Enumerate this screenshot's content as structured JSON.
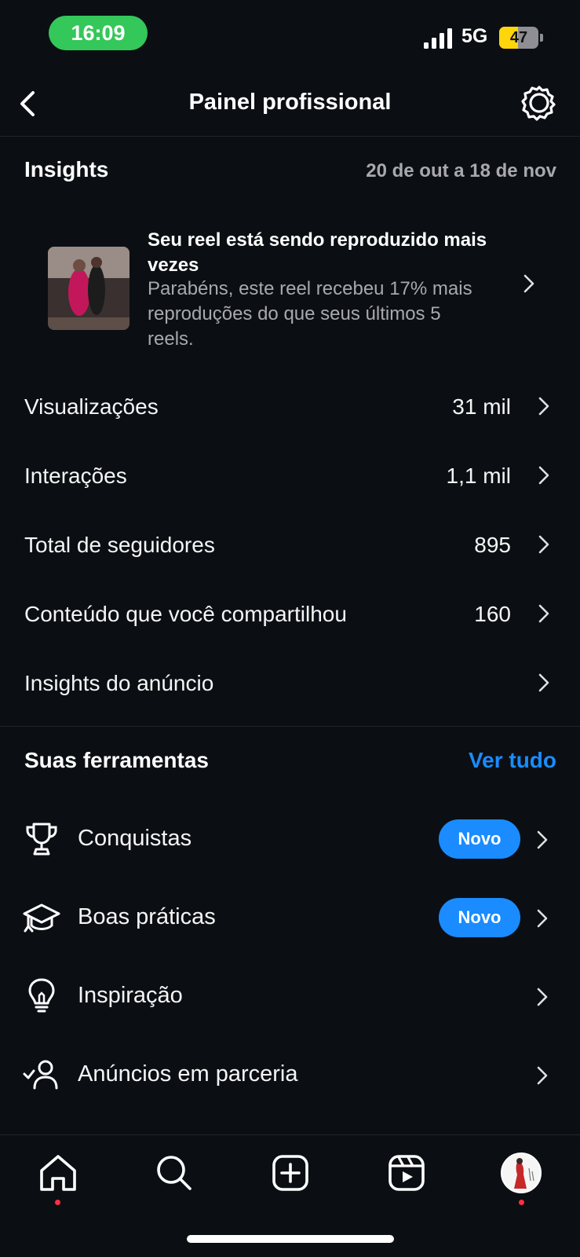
{
  "status_bar": {
    "time": "16:09",
    "network": "5G",
    "battery": "47",
    "battery_level": 0.47,
    "time_pill_color": "#34c759"
  },
  "header": {
    "title": "Painel profissional",
    "back_icon": "chevron-left-icon",
    "settings_icon": "settings-gear-icon"
  },
  "insights": {
    "title": "Insights",
    "date_range": "20 de out a 18 de nov",
    "reel_card": {
      "title": "Seu reel está sendo reproduzido mais vezes",
      "description": "Parabéns, este reel recebeu 17% mais reproduções do que seus últimos 5 reels."
    },
    "metrics": [
      {
        "label": "Visualizações",
        "value": "31 mil"
      },
      {
        "label": "Interações",
        "value": "1,1 mil"
      },
      {
        "label": "Total de seguidores",
        "value": "895"
      },
      {
        "label": "Conteúdo que você compartilhou",
        "value": "160"
      },
      {
        "label": "Insights do anúncio",
        "value": ""
      }
    ]
  },
  "tools": {
    "title": "Suas ferramentas",
    "see_all": "Ver tudo",
    "items": [
      {
        "label": "Conquistas",
        "icon": "trophy-icon",
        "badge": "Novo"
      },
      {
        "label": "Boas práticas",
        "icon": "graduation-cap-icon",
        "badge": "Novo"
      },
      {
        "label": "Inspiração",
        "icon": "lightbulb-icon",
        "badge": ""
      },
      {
        "label": "Anúncios em parceria",
        "icon": "partnership-user-icon",
        "badge": ""
      }
    ]
  },
  "bottom_nav": {
    "items": [
      "home-icon",
      "search-icon",
      "create-plus-icon",
      "reels-icon",
      "profile-avatar"
    ]
  },
  "colors": {
    "background": "#0b0f14",
    "accent": "#1a8cff",
    "secondary_text": "#a8a8ad",
    "notification_dot": "#ff3040"
  }
}
